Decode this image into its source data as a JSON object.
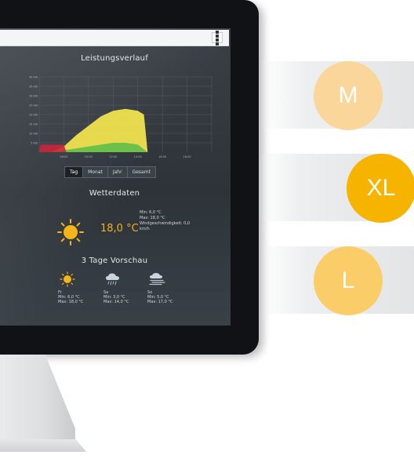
{
  "screen": {
    "performance_title": "Leistungsverlauf",
    "weather_title": "Wetterdaten",
    "forecast_title": "3 Tage Vorschau",
    "menu_icon": "grid-icon"
  },
  "chart_data": {
    "type": "area",
    "title": "Leistungsverlauf",
    "y_ticks": [
      "40 kW",
      "35 kW",
      "30 kW",
      "25 kW",
      "20 kW",
      "15 kW",
      "10 kW",
      "5 kW"
    ],
    "x_ticks": [
      "08:00",
      "10:00",
      "12:00",
      "14:00",
      "16:00",
      "18:00"
    ],
    "ylim": [
      0,
      40
    ],
    "grid": true,
    "series": [
      {
        "color": "#f0e24f",
        "values_by_hour": [
          [
            7,
            0
          ],
          [
            8,
            3
          ],
          [
            9,
            9
          ],
          [
            10,
            14
          ],
          [
            11,
            19
          ],
          [
            12,
            22
          ],
          [
            13,
            23
          ],
          [
            14,
            22
          ],
          [
            14.5,
            20
          ],
          [
            14.8,
            0
          ]
        ]
      },
      {
        "color": "#5fbd4a",
        "values_by_hour": [
          [
            7,
            0
          ],
          [
            8,
            1
          ],
          [
            9,
            2
          ],
          [
            10,
            3
          ],
          [
            11,
            4
          ],
          [
            12,
            5
          ],
          [
            13,
            5
          ],
          [
            14,
            4
          ],
          [
            14.8,
            0
          ]
        ]
      },
      {
        "color": "#c8263a",
        "values_by_hour": [
          [
            6,
            0
          ],
          [
            6.1,
            4
          ],
          [
            8,
            4
          ],
          [
            8.2,
            0
          ]
        ]
      }
    ]
  },
  "period_tabs": [
    "Tag",
    "Monat",
    "Jahr",
    "Gesamt"
  ],
  "active_tab": "Tag",
  "weather_now": {
    "icon": "sun-icon",
    "temperature": "18,0 °C",
    "min": "Min: 6,0 °C",
    "max": "Max: 18,0 °C",
    "wind": "Windgeschwindigkeit: 0,0 km/h"
  },
  "forecast": [
    {
      "day": "Fr",
      "icon": "sun-icon",
      "min": "Min: 6,0 °C",
      "max": "Max: 18,0 °C"
    },
    {
      "day": "Sa",
      "icon": "cloud-rain-icon",
      "min": "Min: 3,0 °C",
      "max": "Max: 14,0 °C"
    },
    {
      "day": "So",
      "icon": "fog-icon",
      "min": "Min: 5,0 °C",
      "max": "Max: 17,0 °C"
    }
  ],
  "sizes": [
    {
      "label": "M",
      "color": "#fbd69a"
    },
    {
      "label": "XL",
      "color": "#f6b400"
    },
    {
      "label": "L",
      "color": "#fbcd68"
    }
  ]
}
